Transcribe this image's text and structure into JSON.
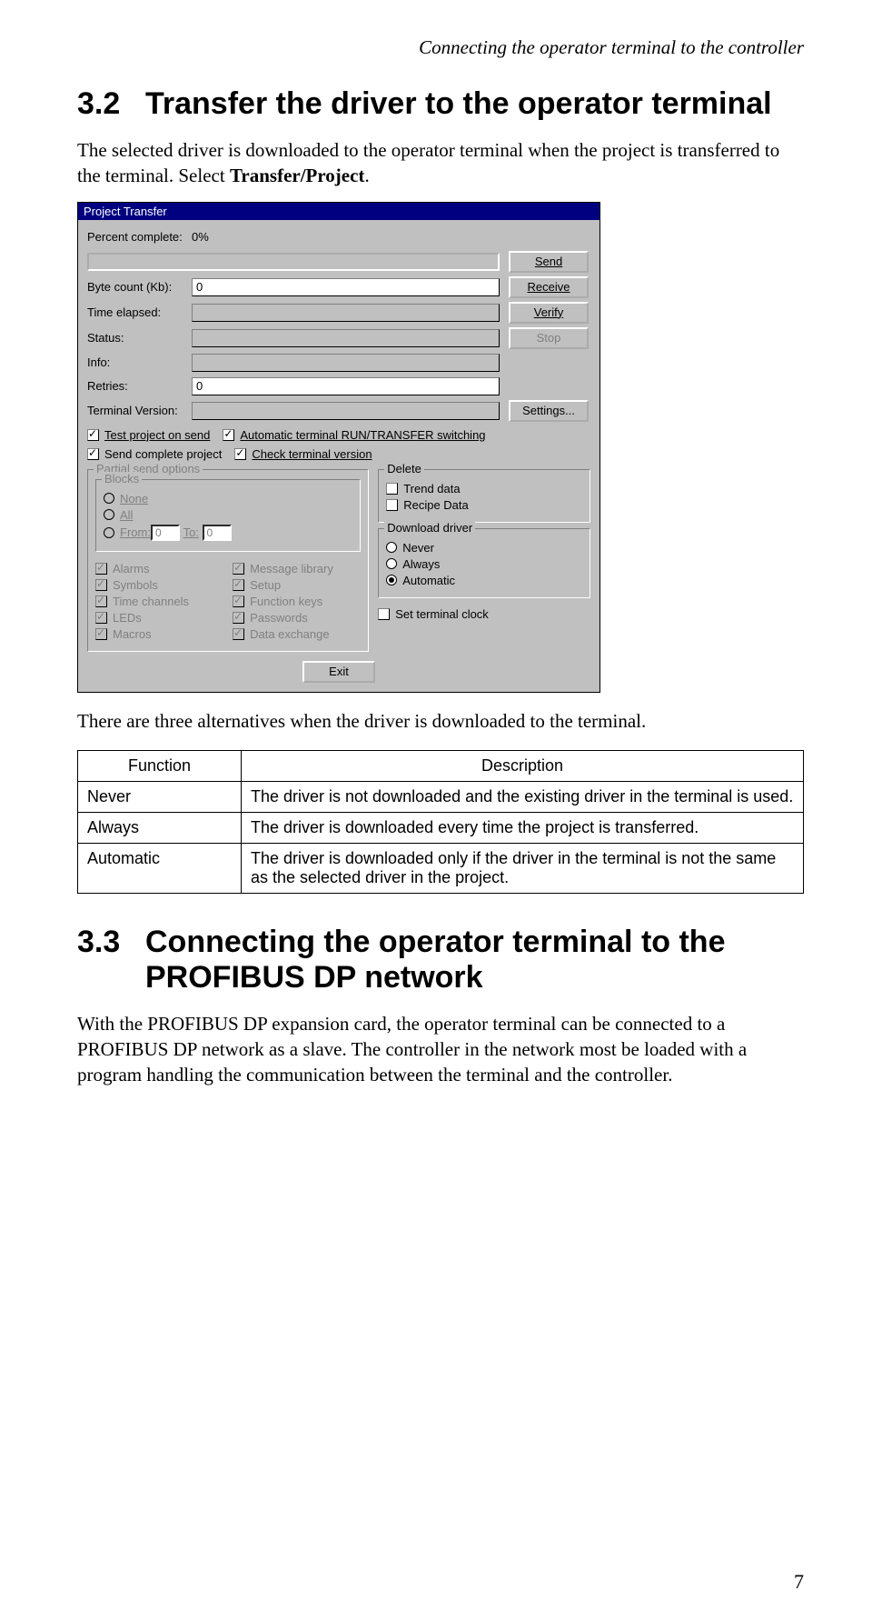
{
  "running_head": "Connecting the operator terminal to the controller",
  "section32": {
    "number": "3.2",
    "title": "Transfer the driver to the operator terminal",
    "para_a": "The selected driver is downloaded to the operator terminal when the project is transferred to the terminal. Select ",
    "para_b_bold": "Transfer/Project",
    "para_c": "."
  },
  "dialog": {
    "title": "Project Transfer",
    "labels": {
      "percent": "Percent complete:",
      "percent_val": "0%",
      "byte": "Byte count (Kb):",
      "byte_val": "0",
      "time": "Time elapsed:",
      "status": "Status:",
      "info": "Info:",
      "retries": "Retries:",
      "retries_val": "0",
      "termver": "Terminal Version:"
    },
    "buttons": {
      "send": "Send",
      "receive": "Receive",
      "verify": "Verify",
      "stop": "Stop",
      "settings": "Settings...",
      "exit": "Exit"
    },
    "checks": {
      "test_send": "Test project on send",
      "auto_switch": "Automatic terminal RUN/TRANSFER switching",
      "send_complete": "Send complete project",
      "check_ver": "Check terminal version"
    },
    "partial": {
      "legend": "Partial send options",
      "blocks": "Blocks",
      "none": "None",
      "all": "All",
      "from": "From:",
      "from_val": "0",
      "to": "To:",
      "to_val": "0",
      "alarms": "Alarms",
      "symbols": "Symbols",
      "timech": "Time channels",
      "leds": "LEDs",
      "macros": "Macros",
      "msglib": "Message library",
      "setup": "Setup",
      "fkeys": "Function keys",
      "passwords": "Passwords",
      "dataex": "Data exchange"
    },
    "delete": {
      "legend": "Delete",
      "trend": "Trend data",
      "recipe": "Recipe Data"
    },
    "download": {
      "legend": "Download driver",
      "never": "Never",
      "always": "Always",
      "auto": "Automatic"
    },
    "setclock": "Set terminal clock"
  },
  "caption": "There are three alternatives when the driver is downloaded to the terminal.",
  "table": {
    "h1": "Function",
    "h2": "Description",
    "rows": [
      {
        "f": "Never",
        "d": "The driver is not downloaded and the existing driver in the terminal is used."
      },
      {
        "f": "Always",
        "d": "The driver is downloaded every time the project is transferred."
      },
      {
        "f": "Automatic",
        "d": "The driver is downloaded only if the driver in the terminal is not the same as the selected driver in the project."
      }
    ]
  },
  "section33": {
    "number": "3.3",
    "title": "Connecting the operator terminal to the PROFIBUS DP network",
    "para": "With the PROFIBUS DP expansion card, the operator terminal can be connected to a PROFIBUS DP network as a slave. The controller in the network most be loaded with a program handling the communication between the terminal and the controller."
  },
  "page_number": "7"
}
